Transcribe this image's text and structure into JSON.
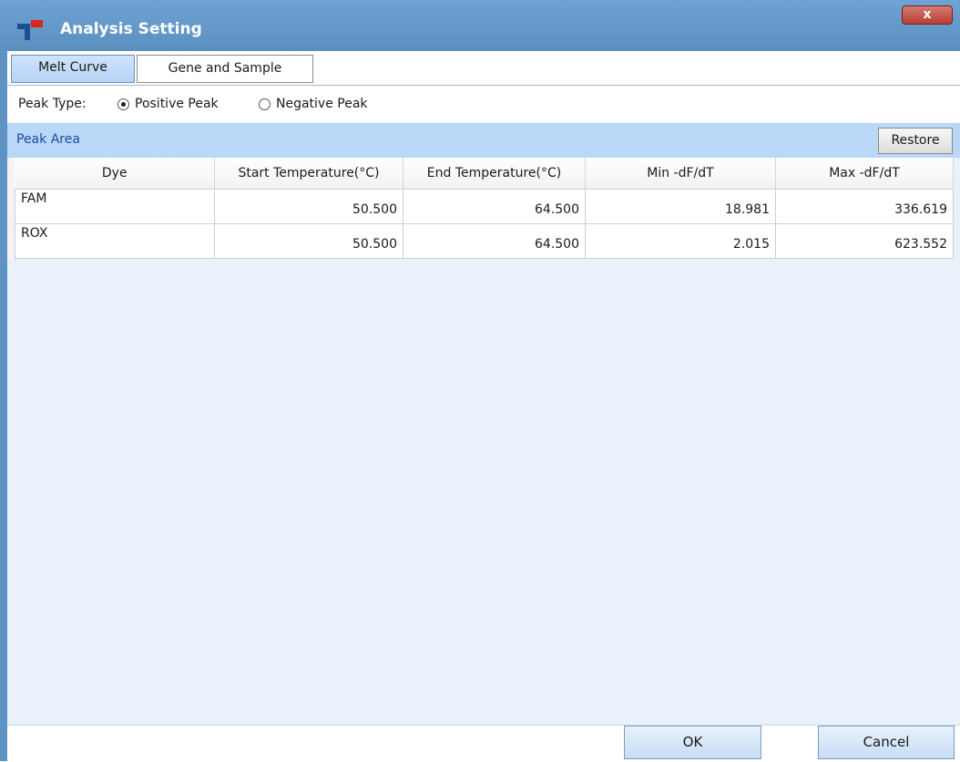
{
  "window": {
    "title": "Analysis Setting",
    "close_label": "x"
  },
  "tabs": [
    {
      "label": "Melt Curve",
      "active": true
    },
    {
      "label": "Gene and Sample",
      "active": false
    }
  ],
  "peak_type": {
    "label": "Peak Type:",
    "options": [
      {
        "label": "Positive Peak",
        "selected": true
      },
      {
        "label": "Negative Peak",
        "selected": false
      }
    ]
  },
  "peak_area": {
    "title": "Peak Area",
    "restore_label": "Restore"
  },
  "table": {
    "columns": [
      "Dye",
      "Start Temperature(°C)",
      "End Temperature(°C)",
      "Min -dF/dT",
      "Max -dF/dT"
    ],
    "rows": [
      [
        "FAM",
        "50.500",
        "64.500",
        "18.981",
        "336.619"
      ],
      [
        "ROX",
        "50.500",
        "64.500",
        "2.015",
        "623.552"
      ]
    ]
  },
  "footer": {
    "ok_label": "OK",
    "cancel_label": "Cancel"
  },
  "colors": {
    "titlebar": "#5f93c3",
    "section_bar": "#b9d7f7",
    "section_title": "#1f4aa0",
    "close_button": "#c0473d"
  }
}
